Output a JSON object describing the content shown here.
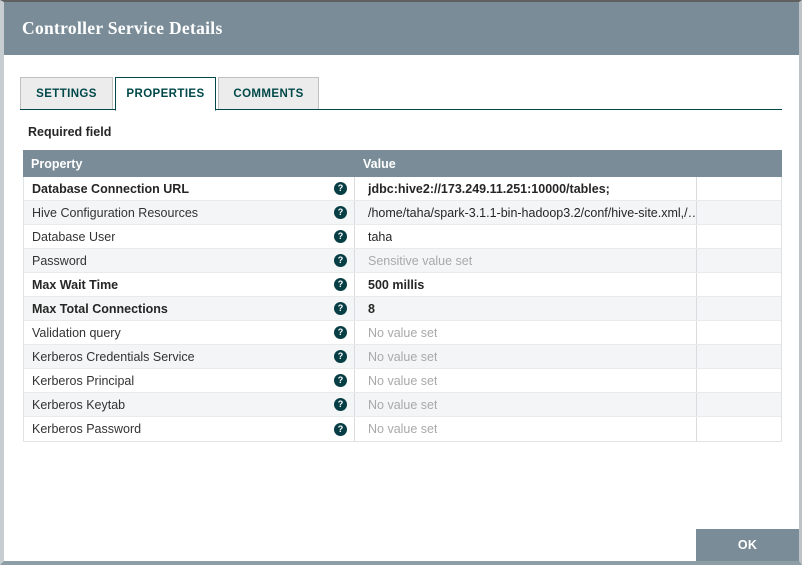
{
  "dialog": {
    "title": "Controller Service Details",
    "tabs": [
      {
        "label": "SETTINGS",
        "active": false
      },
      {
        "label": "PROPERTIES",
        "active": true
      },
      {
        "label": "COMMENTS",
        "active": false
      }
    ],
    "required_field_label": "Required field",
    "ok_label": "OK"
  },
  "table": {
    "columns": [
      "Property",
      "Value"
    ],
    "help_glyph": "?",
    "help_icon": "question-circle-icon",
    "rows": [
      {
        "property": "Database Connection URL",
        "value": "jdbc:hive2://173.249.11.251:10000/tables;",
        "bold": true,
        "value_state": "set"
      },
      {
        "property": "Hive Configuration Resources",
        "value": "/home/taha/spark-3.1.1-bin-hadoop3.2/conf/hive-site.xml,/…",
        "bold": false,
        "value_state": "set"
      },
      {
        "property": "Database User",
        "value": "taha",
        "bold": false,
        "value_state": "set"
      },
      {
        "property": "Password",
        "value": "Sensitive value set",
        "bold": false,
        "value_state": "sensitive"
      },
      {
        "property": "Max Wait Time",
        "value": "500 millis",
        "bold": true,
        "value_state": "set"
      },
      {
        "property": "Max Total Connections",
        "value": "8",
        "bold": true,
        "value_state": "set"
      },
      {
        "property": "Validation query",
        "value": "No value set",
        "bold": false,
        "value_state": "empty"
      },
      {
        "property": "Kerberos Credentials Service",
        "value": "No value set",
        "bold": false,
        "value_state": "empty"
      },
      {
        "property": "Kerberos Principal",
        "value": "No value set",
        "bold": false,
        "value_state": "empty"
      },
      {
        "property": "Kerberos Keytab",
        "value": "No value set",
        "bold": false,
        "value_state": "empty"
      },
      {
        "property": "Kerberos Password",
        "value": "No value set",
        "bold": false,
        "value_state": "empty"
      }
    ]
  },
  "colors": {
    "header_bg": "#7a8c98",
    "accent_teal": "#004849",
    "table_header_bg": "#7a8c98",
    "alt_row_bg": "#f4f5f6",
    "muted_text": "#a9a9a9",
    "ok_button_bg": "#7a8c98"
  }
}
